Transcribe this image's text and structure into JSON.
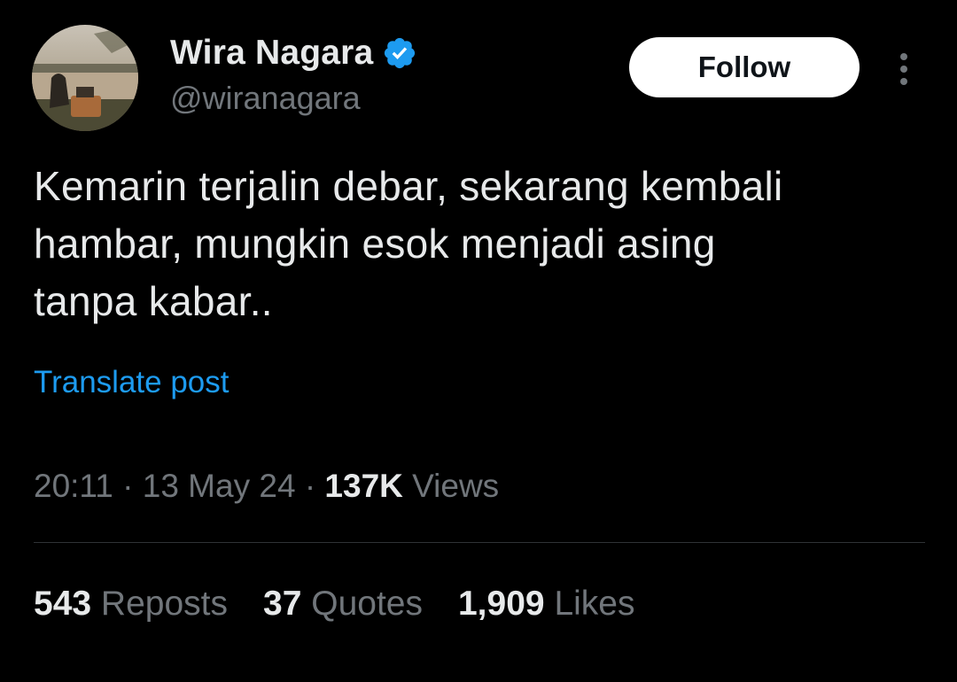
{
  "author": {
    "display_name": "Wira Nagara",
    "handle": "@wiranagara",
    "verified": true,
    "avatar_icon": "avatar-photo"
  },
  "follow_button": {
    "label": "Follow"
  },
  "more_icon": "more-vertical-icon",
  "post": {
    "text": "Kemarin terjalin debar, sekarang kembali\nhambar, mungkin esok menjadi asing\ntanpa kabar..",
    "translate_label": "Translate post"
  },
  "meta": {
    "time": "20:11",
    "separator": "·",
    "date": "13 May 24",
    "views_count": "137K",
    "views_label": "Views"
  },
  "stats": {
    "reposts_count": "543",
    "reposts_label": "Reposts",
    "quotes_count": "37",
    "quotes_label": "Quotes",
    "likes_count": "1,909",
    "likes_label": "Likes"
  },
  "colors": {
    "background": "#000000",
    "primary_text": "#e7e9ea",
    "secondary_text": "#71767b",
    "link": "#1d9bf0",
    "verified_badge": "#1d9bf0",
    "divider": "#2f3336"
  }
}
